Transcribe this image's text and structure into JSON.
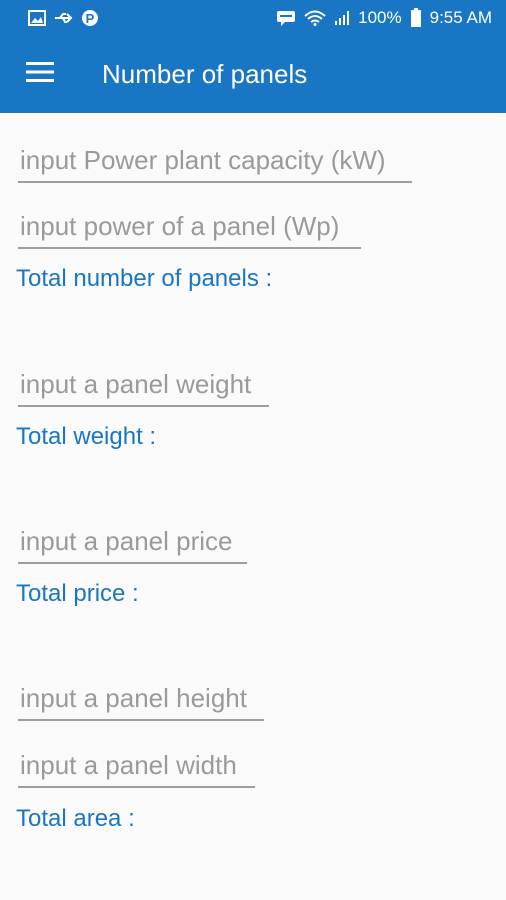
{
  "status_bar": {
    "battery": "100%",
    "time": "9:55 AM",
    "icons": [
      "gallery-icon",
      "usb-icon",
      "p-icon",
      "message-icon",
      "wifi-icon",
      "signal-icon",
      "battery-icon"
    ]
  },
  "app_bar": {
    "title": "Number of panels",
    "menu_icon": "hamburger-icon"
  },
  "form": {
    "capacity_placeholder": "input Power plant capacity (kW)",
    "panel_power_placeholder": "input power of a panel (Wp)",
    "total_panels_label": "Total number of panels :",
    "weight_placeholder": "input a panel weight",
    "total_weight_label": "Total weight :",
    "price_placeholder": "input a panel price",
    "total_price_label": "Total price :",
    "height_placeholder": "input a panel height",
    "width_placeholder": "input a panel width",
    "total_area_label": "Total area :"
  },
  "colors": {
    "primary": "#1976c4",
    "background": "#fafafa",
    "hint": "#9a9a9a"
  }
}
